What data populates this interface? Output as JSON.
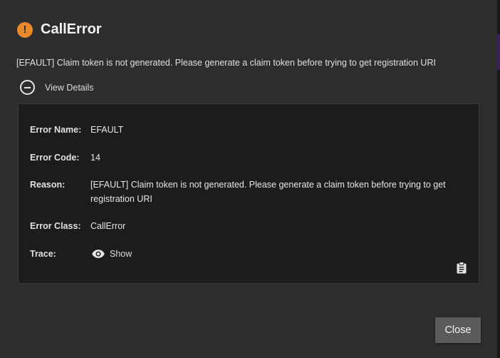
{
  "dialog": {
    "title": "CallError",
    "message": "[EFAULT] Claim token is not generated. Please generate a claim token before trying to get registration URI",
    "details_toggle_label": "View Details",
    "close_label": "Close"
  },
  "details": {
    "error_name_label": "Error Name:",
    "error_name_value": "EFAULT",
    "error_code_label": "Error Code:",
    "error_code_value": "14",
    "reason_label": "Reason:",
    "reason_value": "[EFAULT] Claim token is not generated. Please generate a claim token before trying to get registration URI",
    "error_class_label": "Error Class:",
    "error_class_value": "CallError",
    "trace_label": "Trace:",
    "trace_show_label": "Show"
  },
  "colors": {
    "dialog_bg": "#2d2d2d",
    "panel_bg": "#1c1c1c",
    "warning_accent": "#e9892b",
    "button_bg": "#5a5a5a"
  },
  "icons": {
    "title": "warning-circle-icon",
    "toggle": "minus-circle-icon",
    "trace": "eye-icon",
    "copy": "clipboard-icon"
  }
}
